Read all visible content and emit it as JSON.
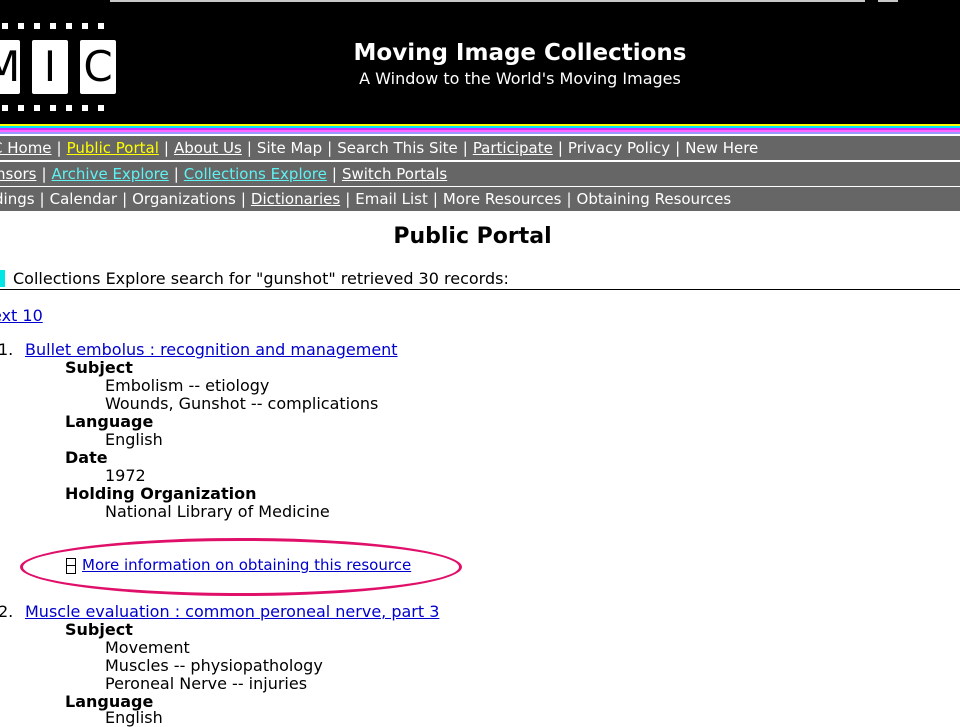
{
  "header": {
    "logo_letters": [
      "M",
      "I",
      "C"
    ],
    "title": "Moving Image Collections",
    "subtitle": "A Window to the World's Moving Images"
  },
  "stripe_colors": [
    "#ffff00",
    "#00e5ff",
    "#cc33ff",
    "#ff66ff",
    "#9999ff"
  ],
  "nav": {
    "row1": [
      "C Home",
      "Public Portal",
      "About Us",
      "Site Map",
      "Search This Site",
      "Participate",
      "Privacy Policy",
      "New Here"
    ],
    "row2": [
      "nsors",
      "Archive Explore",
      "Collections Explore",
      "Switch Portals"
    ],
    "row3": [
      "dings",
      "Calendar",
      "Organizations",
      "Dictionaries",
      "Email List",
      "More Resources",
      "Obtaining Resources"
    ]
  },
  "page": {
    "title": "Public Portal",
    "search_summary": "Collections Explore search for \"gunshot\" retrieved 30 records:",
    "next_link": "ext 10",
    "more_info_link": "More information on obtaining this resource"
  },
  "records": [
    {
      "num": "1.",
      "title": "Bullet embolus : recognition and management",
      "labels": {
        "subject": "Subject",
        "language": "Language",
        "date": "Date",
        "org": "Holding Organization"
      },
      "subject": [
        "Embolism -- etiology",
        "Wounds, Gunshot -- complications"
      ],
      "language": "English",
      "date": "1972",
      "org": "National Library of Medicine"
    },
    {
      "num": "2.",
      "title": "Muscle evaluation : common peroneal nerve, part 3",
      "labels": {
        "subject": "Subject",
        "language": "Language"
      },
      "subject": [
        "Movement",
        "Muscles -- physiopathology",
        "Peroneal Nerve -- injuries"
      ],
      "language": "English"
    }
  ],
  "colors": {
    "highlight_ellipse": "#e0106a",
    "nav_bg": "#666666",
    "active_link": "#ffff00",
    "explore_link": "#5ff2f2"
  }
}
